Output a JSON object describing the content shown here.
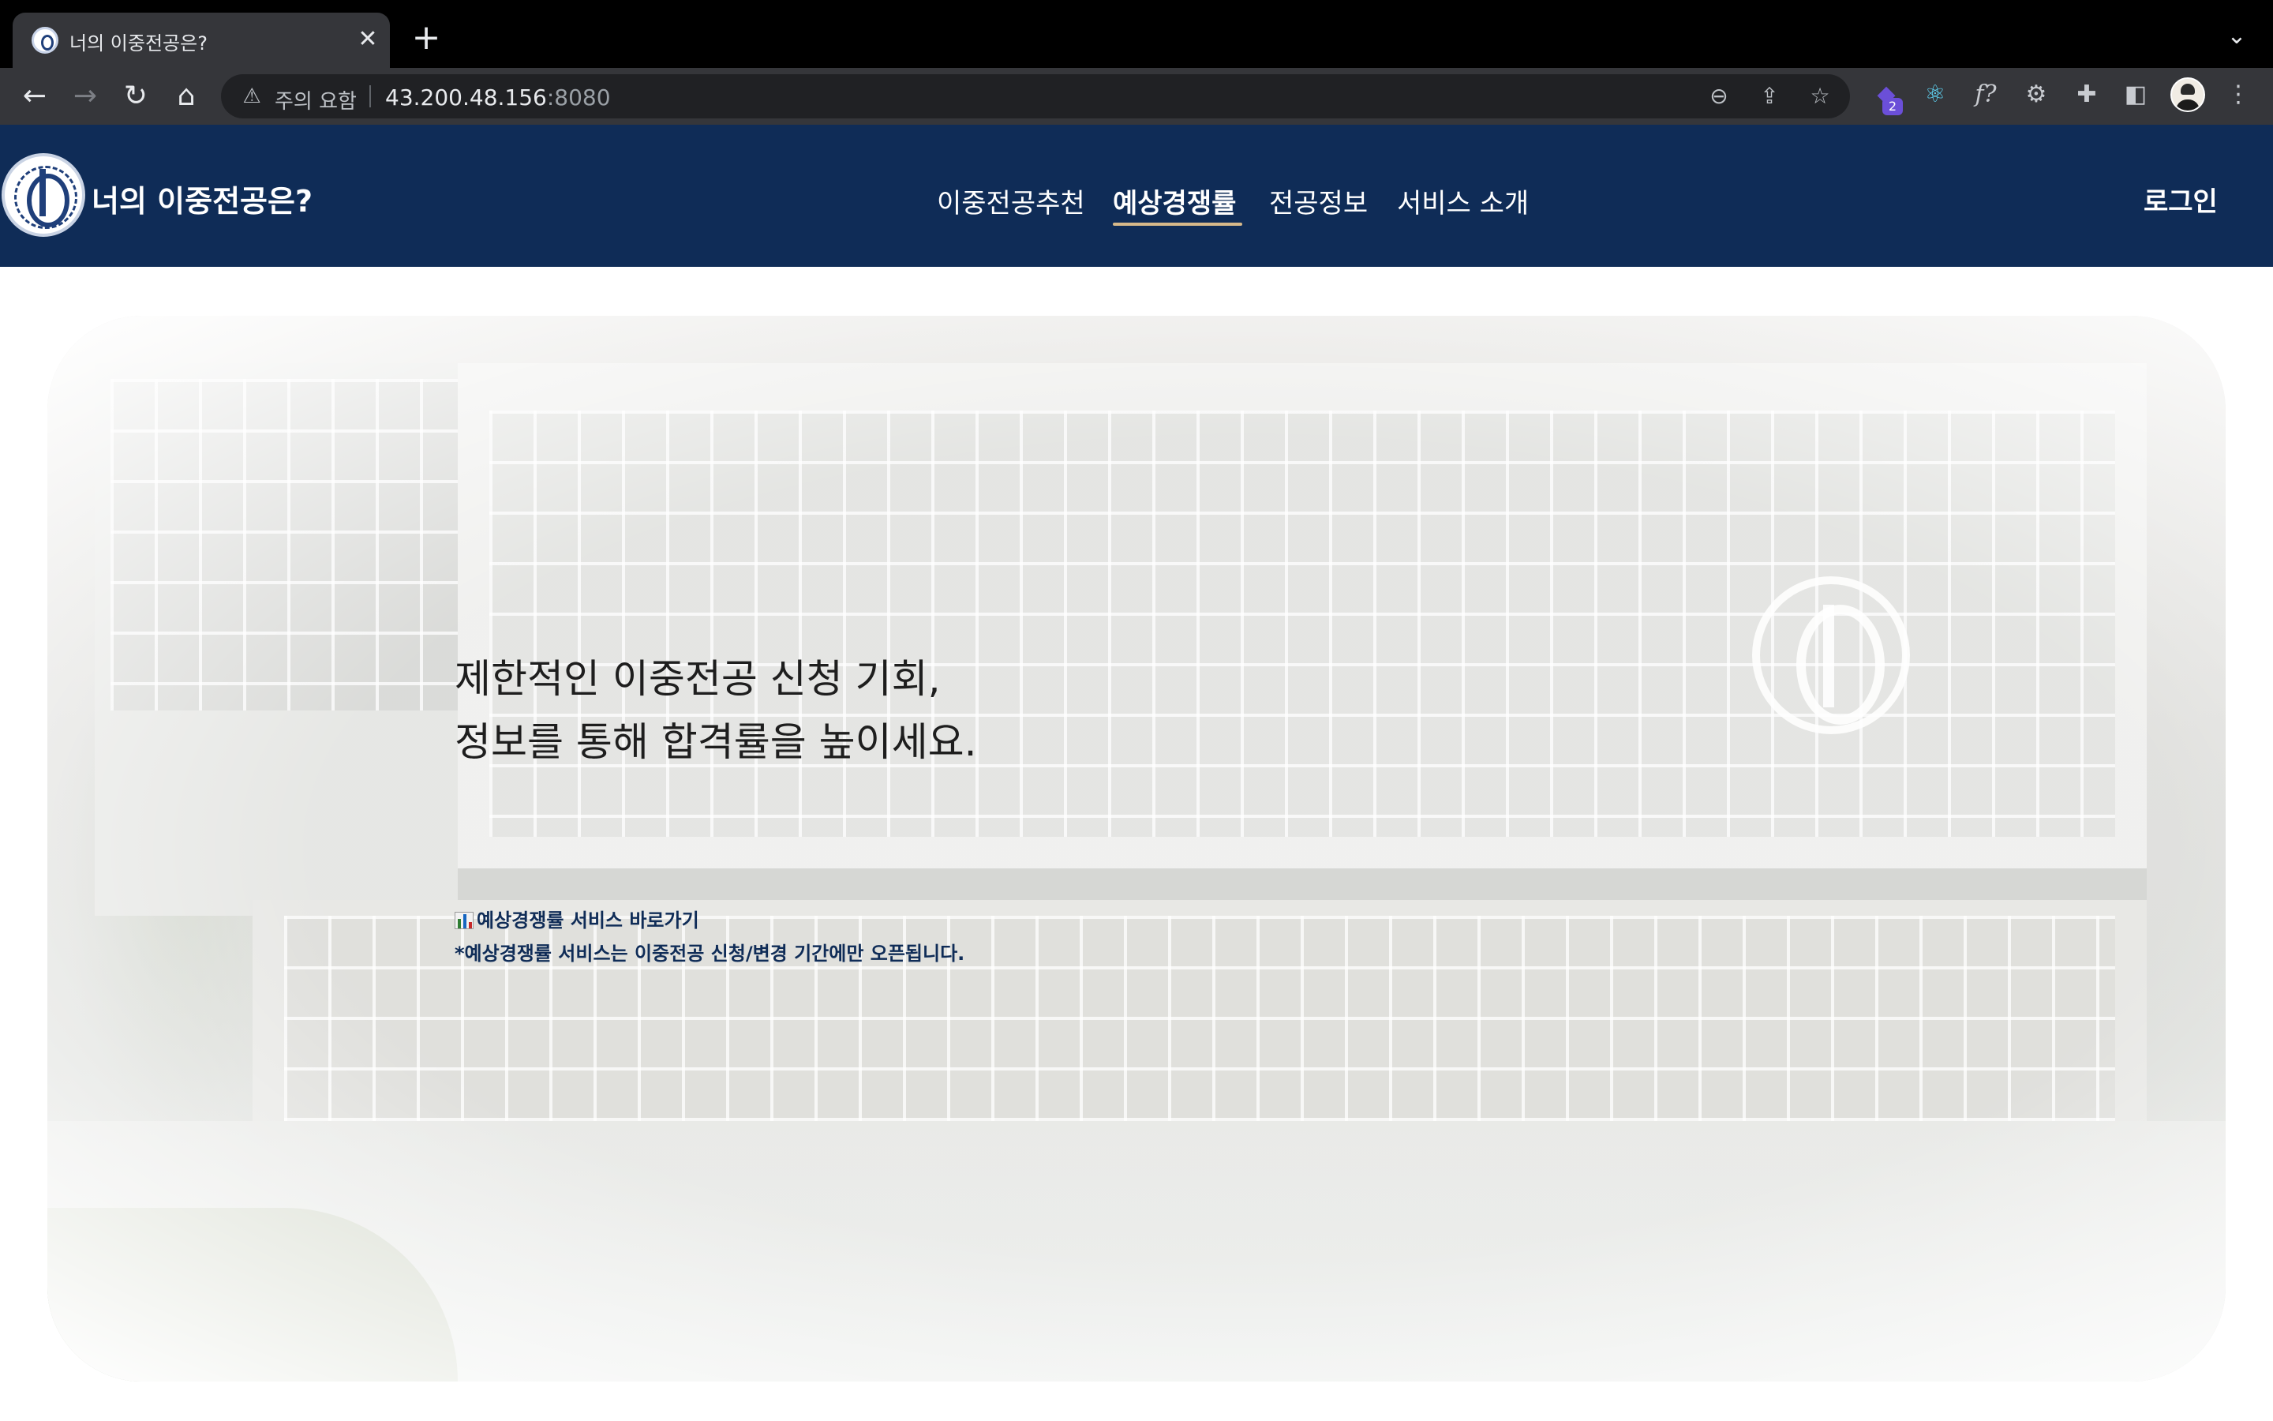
{
  "browser": {
    "tab_title": "너의 이중전공은?",
    "tab_close": "✕",
    "new_tab": "+",
    "tab_menu": "⌄",
    "security_label": "주의 요함",
    "url_host": "43.200.48.156",
    "url_port": ":8080",
    "extension_badge": "2",
    "icons": {
      "back": "back-arrow-icon",
      "forward": "forward-arrow-icon",
      "reload": "reload-icon",
      "home": "home-icon",
      "warning": "warning-triangle-icon",
      "zoom": "zoom-icon",
      "share": "share-icon",
      "bookmark": "star-icon",
      "extensions": "puzzle-icon",
      "side_panel": "side-panel-icon",
      "menu": "kebab-menu-icon"
    }
  },
  "site": {
    "brand": "너의 이중전공은?",
    "nav": [
      {
        "label": "이중전공추천",
        "active": false
      },
      {
        "label": "예상경쟁률",
        "active": true
      },
      {
        "label": "전공정보",
        "active": false
      },
      {
        "label": "서비스 소개",
        "active": false
      }
    ],
    "login": "로그인",
    "colors": {
      "header_bg": "#0f2c57",
      "accent_underline": "#d7b98a",
      "link_text": "#0f2c57"
    }
  },
  "hero": {
    "headline_line1": "제한적인 이중전공 신청 기회,",
    "headline_line2": "정보를 통해 합격률을 높이세요.",
    "service_link": "예상경쟁률 서비스 바로가기",
    "service_link_icon": "bar-chart-emoji-icon",
    "notice": "*예상경쟁률 서비스는 이중전공 신청/변경 기간에만 오픈됩니다."
  }
}
